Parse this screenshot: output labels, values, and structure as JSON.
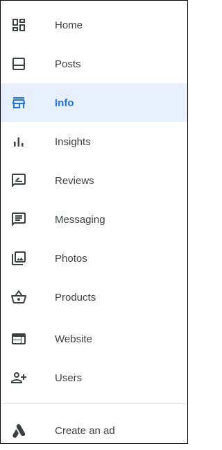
{
  "nav": {
    "items": [
      {
        "label": "Home",
        "icon": "dashboard-icon"
      },
      {
        "label": "Posts",
        "icon": "posts-icon"
      },
      {
        "label": "Info",
        "icon": "storefront-icon",
        "active": true
      },
      {
        "label": "Insights",
        "icon": "bar-chart-icon"
      },
      {
        "label": "Reviews",
        "icon": "rate-review-icon"
      },
      {
        "label": "Messaging",
        "icon": "chat-icon"
      },
      {
        "label": "Photos",
        "icon": "photo-library-icon"
      },
      {
        "label": "Products",
        "icon": "basket-icon"
      },
      {
        "label": "Website",
        "icon": "web-icon"
      },
      {
        "label": "Users",
        "icon": "person-add-icon"
      }
    ]
  },
  "footer": {
    "label": "Create an ad",
    "icon": "google-ads-icon"
  },
  "colors": {
    "accent": "#1a73e8",
    "active_bg": "#e8f0fe",
    "icon": "#3c4043",
    "text": "#3c4043"
  }
}
